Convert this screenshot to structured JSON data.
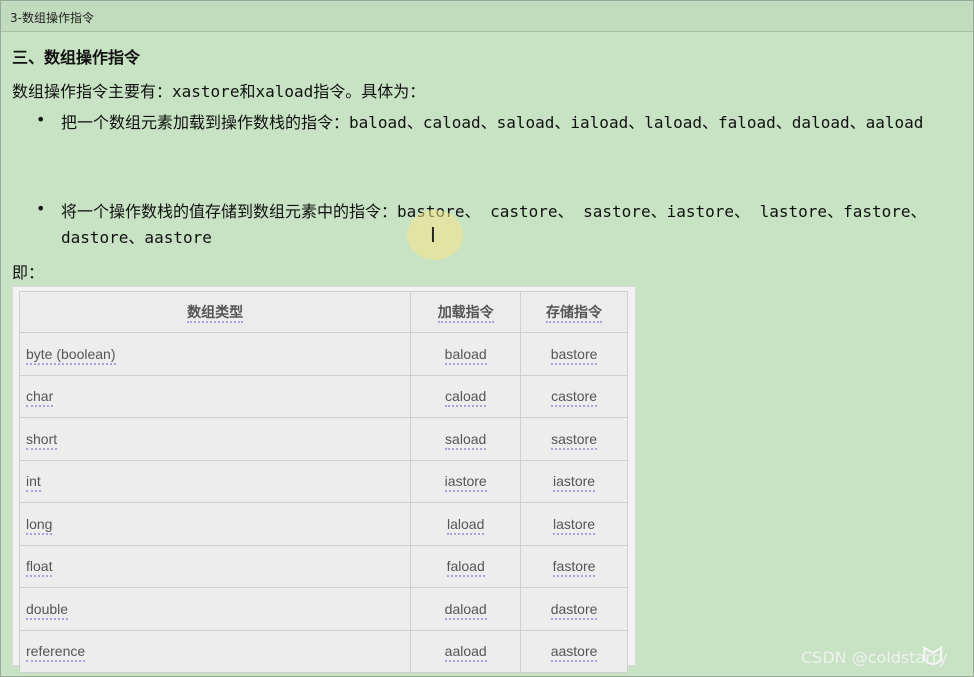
{
  "window": {
    "title": "3-数组操作指令"
  },
  "content": {
    "heading": "三、数组操作指令",
    "intro_prefix": "数组操作指令主要有：",
    "intro_code_1": "xastore",
    "intro_mid": "和",
    "intro_code_2": "xaload",
    "intro_suffix": "指令。具体为：",
    "bullets": [
      {
        "text_prefix": "把一个数组元素加载到操作数栈的指令：",
        "code": "baload、caload、saload、iaload、laload、faload、daload、aaload"
      },
      {
        "text_prefix": "将一个操作数栈的值存储到数组元素中的指令：",
        "code": "bastore、 castore、 sastore、iastore、 lastore、fastore、dastore、aastore"
      }
    ],
    "ji": "即："
  },
  "table": {
    "headers": [
      "数组类型",
      "加载指令",
      "存储指令"
    ],
    "rows": [
      [
        "byte (boolean)",
        "baload",
        "bastore"
      ],
      [
        "char",
        "caload",
        "castore"
      ],
      [
        "short",
        "saload",
        "sastore"
      ],
      [
        "int",
        "iastore",
        "iastore"
      ],
      [
        "long",
        "laload",
        "lastore"
      ],
      [
        "float",
        "faload",
        "fastore"
      ],
      [
        "double",
        "daload",
        "dastore"
      ],
      [
        "reference",
        "aaload",
        "aastore"
      ]
    ]
  },
  "overlay": {
    "watermark": "CSDN @coldstarry",
    "cursor_icon": "text-cursor-icon",
    "logo_icon": "bilibili-corner-icon"
  },
  "colors": {
    "background": "#c7e3c3",
    "table_bg": "#f2f2f2",
    "link_underline": "#a8a4d8"
  }
}
